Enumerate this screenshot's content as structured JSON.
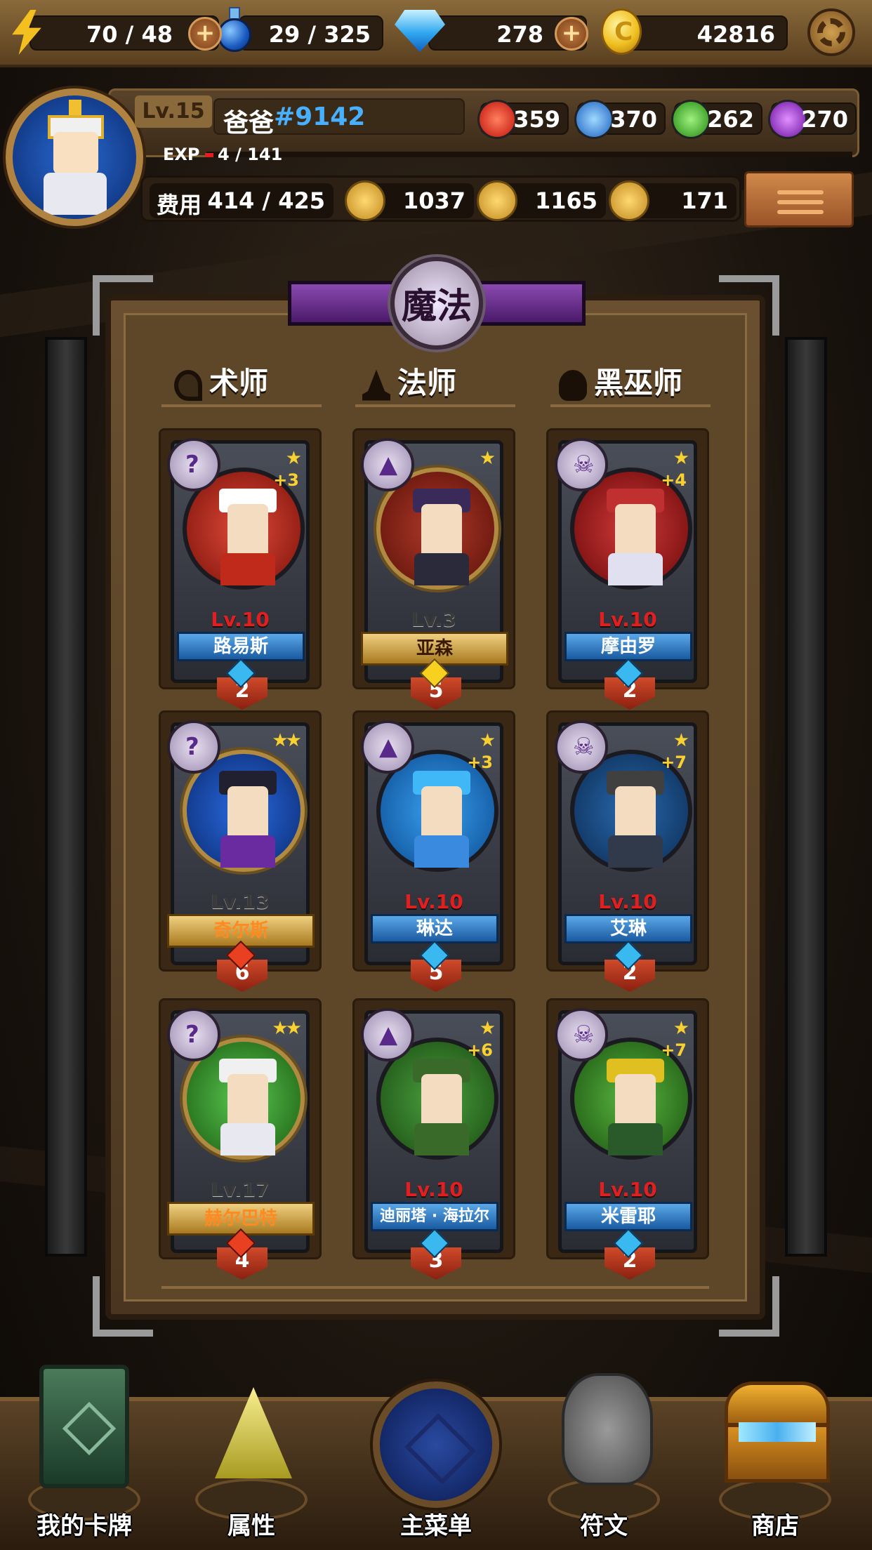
{
  "resources": {
    "energy": "70 / 48",
    "potion": "29 / 325",
    "gems": "278",
    "gold": "42816"
  },
  "profile": {
    "level": "Lv.15",
    "name": "爸爸",
    "tag": "#9142",
    "exp_label": "EXP",
    "exp_value": "4 / 141",
    "elements": {
      "fire": "359",
      "water": "370",
      "nature": "262",
      "dark": "270"
    },
    "cost_label": "费用",
    "cost": "414 / 425",
    "attack": "1037",
    "hp": "1165",
    "heal": "171"
  },
  "colors": {
    "fire": "#e02818",
    "water": "#2a88e8",
    "nature": "#40b830",
    "dark": "#9a30d0",
    "accent_purple": "#6a2a9a",
    "level_red": "#e02020",
    "plate_blue": "#2a78c8",
    "plate_gold": "#d0a040"
  },
  "board": {
    "title": "魔法",
    "columns": [
      {
        "label": "术师",
        "icon": "staff-icon"
      },
      {
        "label": "法师",
        "icon": "wizard-hat-icon"
      },
      {
        "label": "黑巫师",
        "icon": "skull-icon"
      }
    ]
  },
  "cards": [
    {
      "name": "路易斯",
      "level": "Lv.10",
      "stars": "★",
      "plus": "+3",
      "count": "2",
      "class_icon": "staff-icon",
      "rarity": "blue"
    },
    {
      "name": "亚森",
      "level": "Lv.3",
      "stars": "★",
      "plus": "",
      "count": "5",
      "class_icon": "wizard-hat-icon",
      "rarity": "gold"
    },
    {
      "name": "摩由罗",
      "level": "Lv.10",
      "stars": "★",
      "plus": "+4",
      "count": "2",
      "class_icon": "skull-icon",
      "rarity": "blue"
    },
    {
      "name": "奇尔斯",
      "level": "Lv.13",
      "stars": "★★",
      "plus": "",
      "count": "6",
      "class_icon": "staff-icon",
      "rarity": "gold-orange"
    },
    {
      "name": "琳达",
      "level": "Lv.10",
      "stars": "★",
      "plus": "+3",
      "count": "5",
      "class_icon": "wizard-hat-icon",
      "rarity": "blue"
    },
    {
      "name": "艾琳",
      "level": "Lv.10",
      "stars": "★",
      "plus": "+7",
      "count": "2",
      "class_icon": "skull-icon",
      "rarity": "blue"
    },
    {
      "name": "赫尔巴特",
      "level": "Lv.17",
      "stars": "★★",
      "plus": "",
      "count": "4",
      "class_icon": "staff-icon",
      "rarity": "gold-orange"
    },
    {
      "name": "迪丽塔 · 海拉尔",
      "level": "Lv.10",
      "stars": "★",
      "plus": "+6",
      "count": "3",
      "class_icon": "wizard-hat-icon",
      "rarity": "blue"
    },
    {
      "name": "米雷耶",
      "level": "Lv.10",
      "stars": "★",
      "plus": "+7",
      "count": "2",
      "class_icon": "skull-icon",
      "rarity": "blue"
    }
  ],
  "nav": [
    {
      "label": "我的卡牌",
      "icon": "cards-icon"
    },
    {
      "label": "属性",
      "icon": "pyramid-icon"
    },
    {
      "label": "主菜单",
      "icon": "emblem-icon"
    },
    {
      "label": "符文",
      "icon": "rune-stone-icon"
    },
    {
      "label": "商店",
      "icon": "treasure-chest-icon"
    }
  ]
}
